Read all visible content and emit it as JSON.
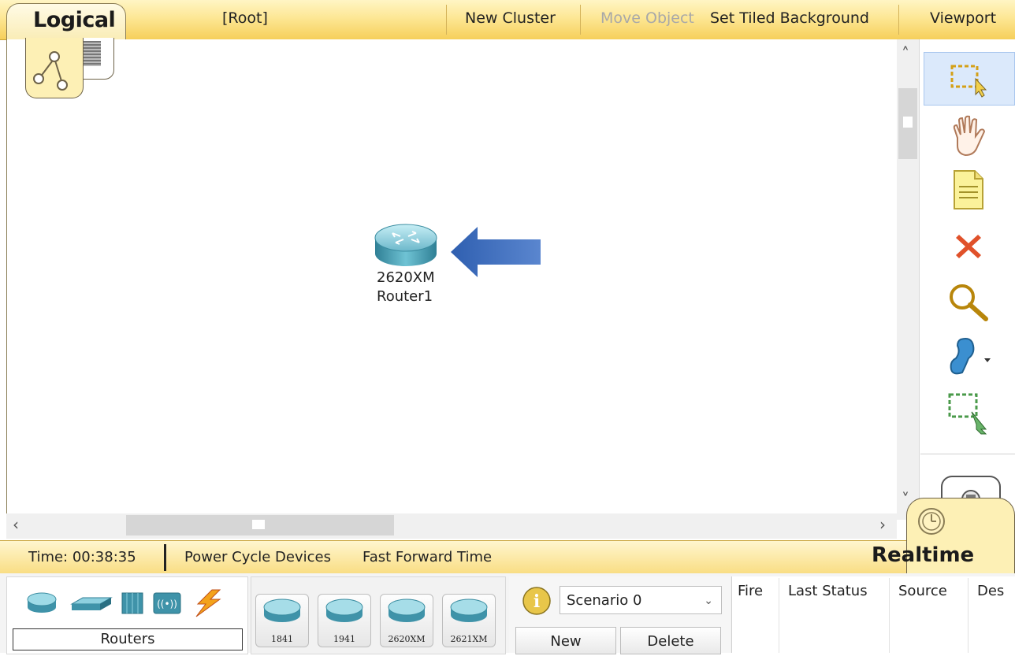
{
  "topbar": {
    "mode_label": "Logical",
    "breadcrumb": "[Root]",
    "new_cluster": "New Cluster",
    "move_object": "Move Object",
    "set_tiled_background": "Set Tiled Background",
    "viewport": "Viewport"
  },
  "workspace": {
    "device": {
      "model": "2620XM",
      "name": "Router1",
      "icon": "router-icon"
    },
    "annotation": "blue-arrow-pointer"
  },
  "toolbar": {
    "tools": [
      "select-icon",
      "hand-icon",
      "note-icon",
      "delete-icon",
      "inspect-icon",
      "draw-shape-icon",
      "resize-icon"
    ]
  },
  "statusbar": {
    "time": "Time: 00:38:35",
    "power_cycle": "Power Cycle Devices",
    "fast_forward": "Fast Forward Time",
    "mode": "Realtime"
  },
  "devices": {
    "category_label": "Routers",
    "models": [
      "1841",
      "1941",
      "2620XM",
      "2621XM"
    ]
  },
  "scenario": {
    "selected": "Scenario 0",
    "new_label": "New",
    "delete_label": "Delete"
  },
  "events": {
    "columns": [
      "Fire",
      "Last Status",
      "Source",
      "Des"
    ]
  },
  "colors": {
    "bar_gold": "#f9dd82",
    "router_teal": "#4f9fb3",
    "arrow_blue": "#3d6fbf",
    "delete_red": "#e0512a"
  }
}
